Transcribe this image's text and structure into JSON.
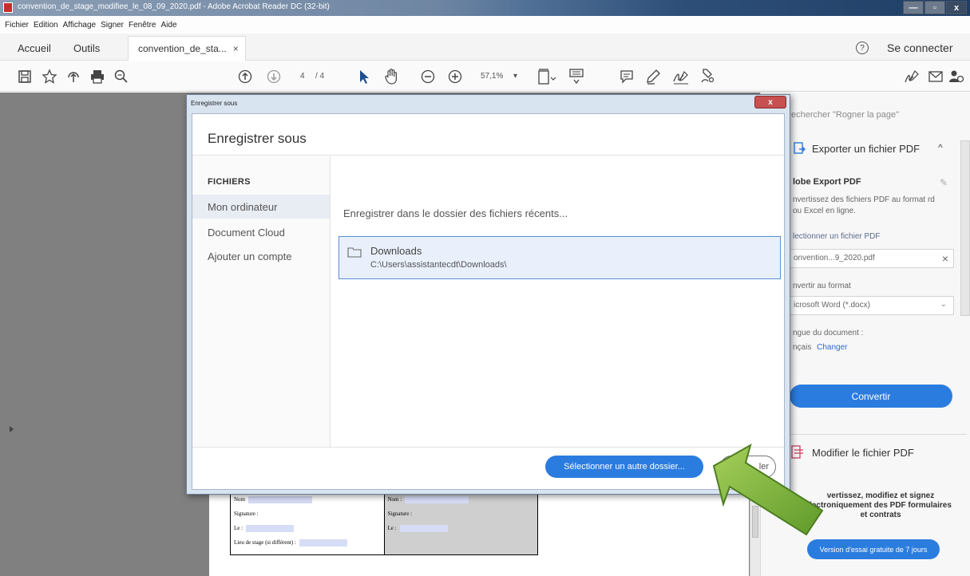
{
  "window": {
    "title": "convention_de_stage_modifiee_le_08_09_2020.pdf - Adobe Acrobat Reader DC (32-bit)",
    "min": "—",
    "max": "▫",
    "close": "x"
  },
  "menu": [
    "Fichier",
    "Edition",
    "Affichage",
    "Signer",
    "Fenêtre",
    "Aide"
  ],
  "tabs": {
    "home": "Accueil",
    "tools": "Outils",
    "document": "convention_de_sta...",
    "close": "×",
    "help": "?",
    "connect": "Se connecter"
  },
  "toolbar": {
    "page_current": "4",
    "page_total": "/ 4",
    "zoom": "57,1%",
    "zoom_caret": "▾"
  },
  "dialog": {
    "window_title": "Enregistrer sous",
    "close": "x",
    "heading": "Enregistrer sous",
    "section": "FICHIERS",
    "items": [
      "Mon ordinateur",
      "Document Cloud",
      "Ajouter un compte"
    ],
    "recent_text": "Enregistrer dans le dossier des fichiers récents...",
    "folder_name": "Downloads",
    "folder_path": "C:\\Users\\assistantecdt\\Downloads\\",
    "select_button": "Sélectionner un autre dossier...",
    "cancel_button": "ler"
  },
  "right_pane": {
    "search_placeholder": "echercher \"Rogner la page\"",
    "export_title": "Exporter un fichier PDF",
    "caret": "^",
    "adobe_export": "lobe Export PDF",
    "description": "nvertissez des fichiers PDF au format rd ou Excel en ligne.",
    "select_label": "lectionner un fichier PDF",
    "selected_file": "onvention...9_2020.pdf",
    "clear": "×",
    "convert_label": "nvertir au format",
    "format": "icrosoft Word (*.docx)",
    "format_caret": "⌄",
    "language_label": "ngue du document :",
    "language": "nçais",
    "change": "Changer",
    "convert_button": "Convertir",
    "edit_title": "Modifier le fichier PDF",
    "promo": "vertissez, modifiez et signez lectroniquement des PDF formulaires et contrats",
    "trial_button": "Version d'essai gratuite de 7 jours"
  },
  "pdf_page": {
    "left_name": "Nom",
    "left_signature": "Signature :",
    "left_date": "Le :",
    "left_place": "Lieu de stage (si différent) :",
    "right_name": "Nom :",
    "right_signature": "Signature :",
    "right_date": "Le :"
  },
  "colors": {
    "accent": "#2b7cdf",
    "dialog_frame": "#d9e4f1",
    "doc_background": "#808080",
    "arrow_green": "#7db23a"
  }
}
